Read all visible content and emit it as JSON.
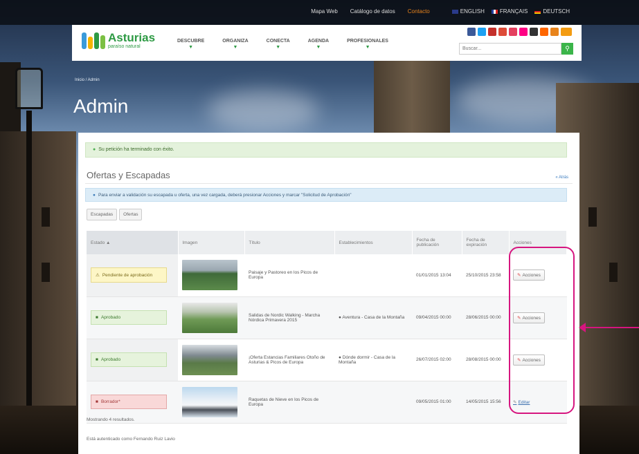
{
  "topbar": {
    "links": [
      "Mapa Web",
      "Catálogo de datos",
      "Contacto"
    ],
    "languages": [
      "ENGLISH",
      "FRANÇAIS",
      "DEUTSCH"
    ]
  },
  "header": {
    "logo_title": "Asturias",
    "logo_subtitle": "paraíso natural",
    "nav": [
      "DESCUBRE",
      "ORGANIZA",
      "CONECTA",
      "AGENDA",
      "PROFESIONALES"
    ],
    "search_placeholder": "Buscar..."
  },
  "page": {
    "breadcrumb": "Inicio / Admin",
    "title": "Admin"
  },
  "main": {
    "success_msg": "Su petición ha terminado con éxito.",
    "section_title": "Ofertas y Escapadas",
    "back_link": "« Atrás",
    "info_msg": "Para enviar a validación su escapada u oferta, una vez cargada, deberá presionar Acciones y marcar \"Solicitud de Aprobación\"",
    "tabs": [
      "Escapadas",
      "Ofertas"
    ],
    "columns": [
      "Estado ▲",
      "Imagen",
      "Título",
      "Establecimientos",
      "Fecha de publicación",
      "Fecha de expiración",
      "Acciones"
    ],
    "rows": [
      {
        "status": "Pendiente de aprobación",
        "status_type": "pending",
        "title": "Paisaje y Pastoreo en los Picos de Europa",
        "establishments": "",
        "pub_date": "01/01/2015 13:04",
        "exp_date": "25/10/2015 23:58",
        "action": "Acciones"
      },
      {
        "status": "Aprobado",
        "status_type": "approved",
        "title": "Salidas de Nordic Walking - Marcha Nórdica Primavera 2015",
        "establishments": "Aventura - Casa de la Montaña",
        "pub_date": "09/04/2015 00:00",
        "exp_date": "28/06/2015 00:00",
        "action": "Acciones"
      },
      {
        "status": "Aprobado",
        "status_type": "approved",
        "title": "¡Oferta Estancias Familiares Otoño de Asturias & Picos de Europa",
        "establishments": "Dónde dormir - Casa de la Montaña",
        "pub_date": "26/07/2015 02:00",
        "exp_date": "28/08/2015 00:00",
        "action": "Acciones"
      },
      {
        "status": "Borrador*",
        "status_type": "draft",
        "title": "Raquetas de Nieve en los Picos de Europa",
        "establishments": "",
        "pub_date": "09/05/2015 01:00",
        "exp_date": "14/05/2015 15:56",
        "action": "Editar"
      }
    ],
    "count_text": "Mostrando 4 resultados.",
    "user_text": "Está autenticado como Fernando Ruiz Lavio"
  },
  "colors": {
    "brand_green": "#2e9a44",
    "callout": "#d6157f",
    "pending": "#fdf6c6",
    "approved": "#e6f3dc",
    "draft": "#f9d8d8"
  }
}
